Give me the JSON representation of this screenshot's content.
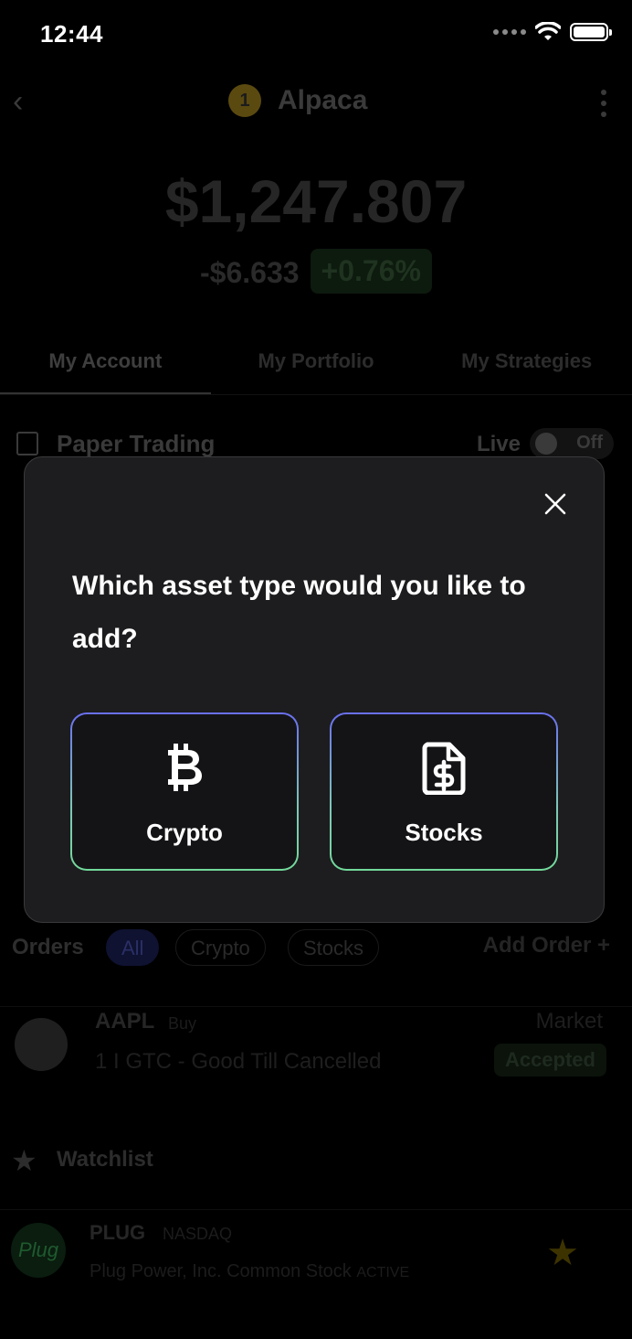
{
  "status_bar": {
    "time": "12:44"
  },
  "header": {
    "title": "Alpaca",
    "coin_glyph": "1"
  },
  "account": {
    "balance": "$1,247.807",
    "change_abs": "-$6.633",
    "change_pct": "+0.76%"
  },
  "tabs": [
    {
      "label": "My Account",
      "active": true
    },
    {
      "label": "My Portfolio",
      "active": false
    },
    {
      "label": "My Strategies",
      "active": false
    }
  ],
  "paper_trading": {
    "label": "Paper Trading",
    "live_label": "Live",
    "toggle_state": "Off"
  },
  "orders": {
    "title": "Orders",
    "filters": [
      "All",
      "Crypto",
      "Stocks"
    ],
    "selected_filter": "All",
    "add_label": "Add Order",
    "items": [
      {
        "symbol": "AAPL",
        "side": "Buy",
        "description": "1 I GTC - Good Till Cancelled",
        "type": "Market",
        "status": "Accepted"
      }
    ]
  },
  "watchlist": {
    "title": "Watchlist",
    "items": [
      {
        "symbol": "PLUG",
        "exchange": "NASDAQ",
        "name": "Plug Power, Inc. Common Stock",
        "status": "ACTIVE",
        "logo_text": "Plug"
      }
    ]
  },
  "modal": {
    "question": "Which asset type would you like to add?",
    "options": [
      {
        "label": "Crypto",
        "icon": "bitcoin-icon"
      },
      {
        "label": "Stocks",
        "icon": "dollar-document-icon"
      }
    ]
  },
  "colors": {
    "background": "#000000",
    "modal_bg": "#1d1d1f",
    "option_border_top": "#6a6ff0",
    "option_border_bottom": "#72d99a"
  }
}
